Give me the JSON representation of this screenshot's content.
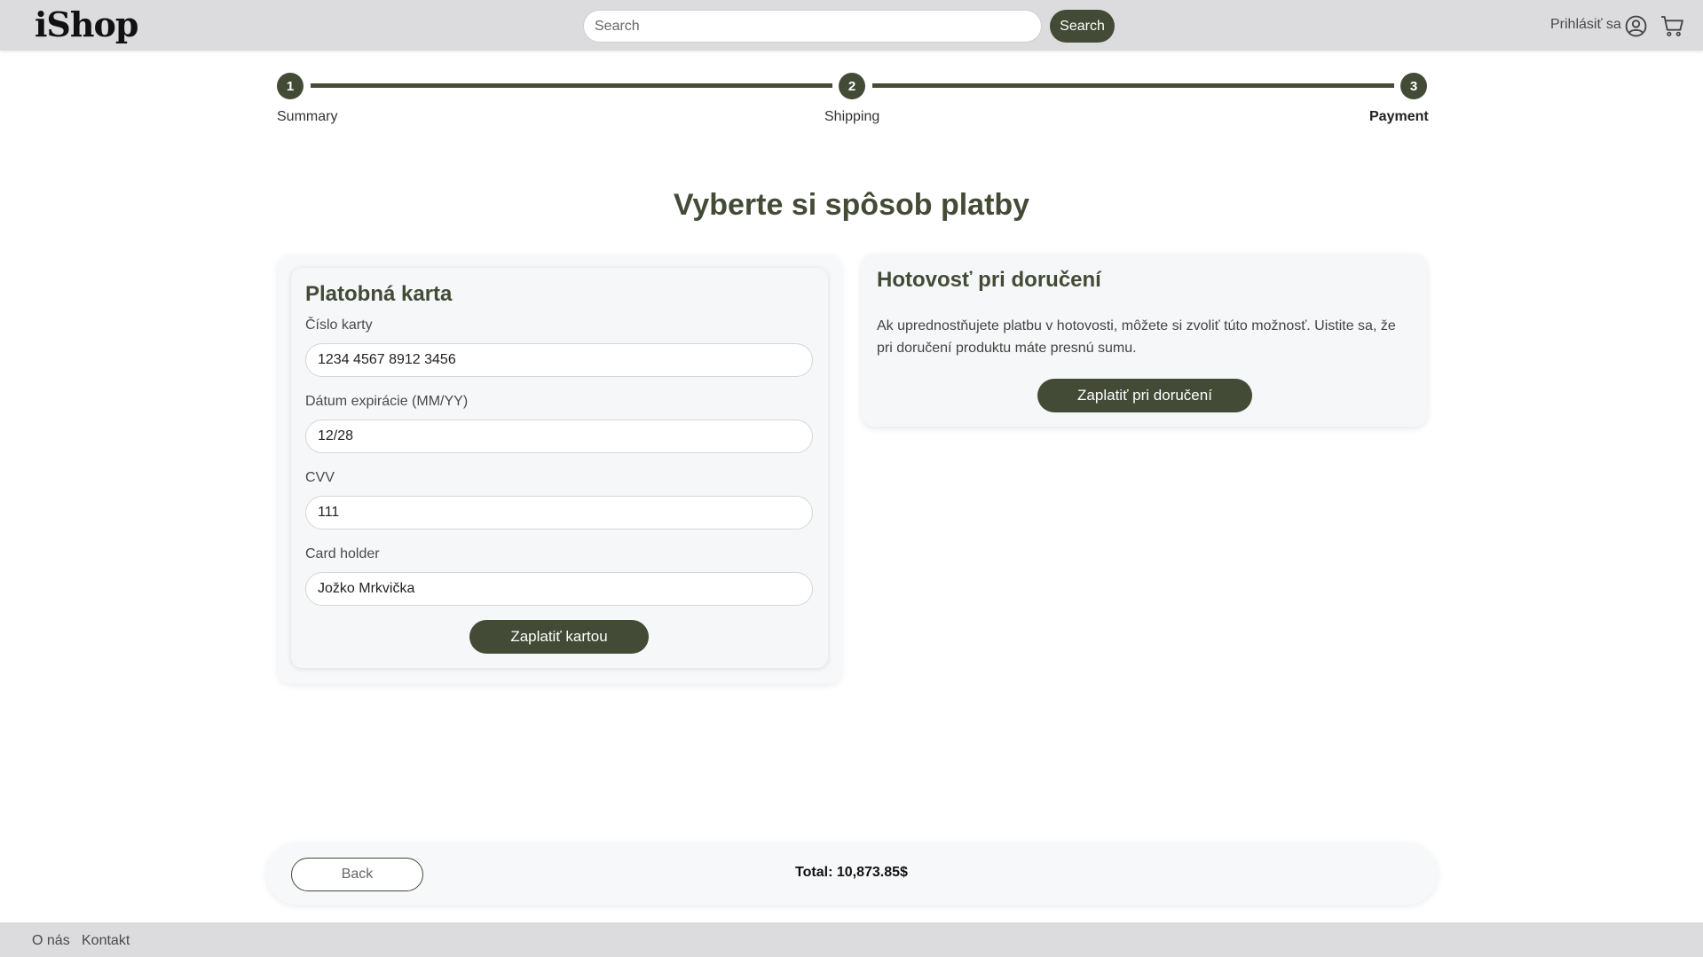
{
  "header": {
    "logo": "iShop",
    "search_placeholder": "Search",
    "search_button": "Search",
    "login_label": "Prihlásiť sa"
  },
  "stepper": {
    "steps": [
      {
        "number": "1",
        "label": "Summary"
      },
      {
        "number": "2",
        "label": "Shipping"
      },
      {
        "number": "3",
        "label": "Payment"
      }
    ],
    "active_step": 3
  },
  "main": {
    "title": "Vyberte si spôsob platby"
  },
  "card_payment": {
    "title": "Platobná karta",
    "fields": [
      {
        "label": "Číslo karty",
        "value": "1234 4567 8912 3456"
      },
      {
        "label": "Dátum expirácie (MM/YY)",
        "value": "12/28"
      },
      {
        "label": "CVV",
        "value": "111"
      },
      {
        "label": "Card holder",
        "value": "Jožko Mrkvička"
      }
    ],
    "pay_button": "Zaplatiť kartou"
  },
  "cash_payment": {
    "title": "Hotovosť pri doručení",
    "description": "Ak uprednostňujete platbu v hotovosti, môžete si zvoliť túto možnosť. Uistite sa, že pri doručení produktu máte presnú sumu.",
    "pay_button": "Zaplatiť pri doručení"
  },
  "bottom_bar": {
    "back_button": "Back",
    "total": "Total: 10,873.85$"
  },
  "footer": {
    "links": [
      "O nás",
      "Kontakt"
    ]
  },
  "colors": {
    "accent": "#434b36",
    "header_bg": "#dcdcdf",
    "panel_bg": "#f6f7f8"
  }
}
